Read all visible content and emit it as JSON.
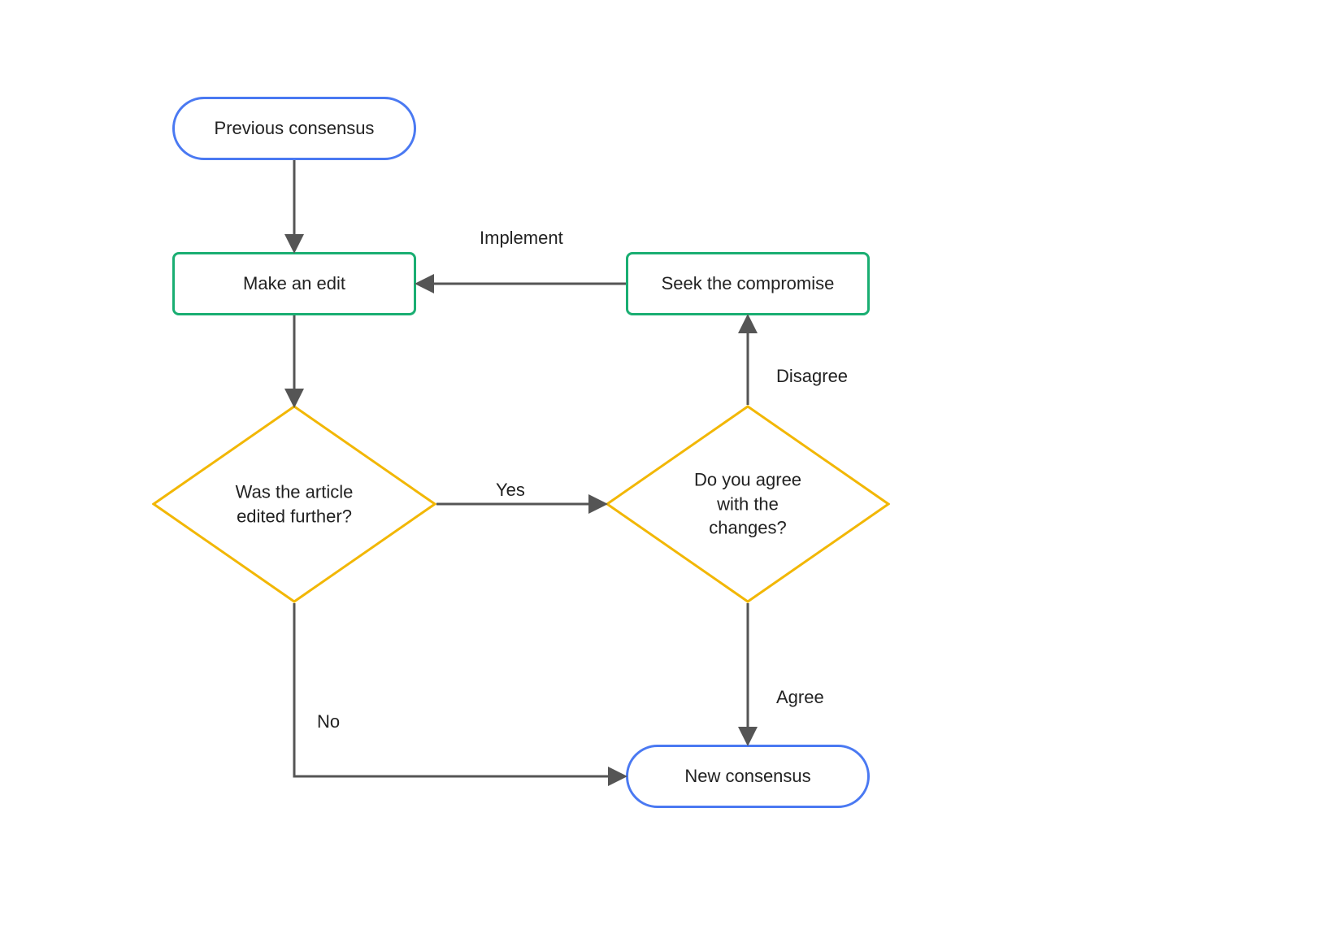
{
  "diagram": {
    "type": "flowchart",
    "nodes": {
      "previous_consensus": {
        "label": "Previous consensus",
        "shape": "terminator",
        "borderColor": "#4A79F2"
      },
      "make_edit": {
        "label": "Make an edit",
        "shape": "process",
        "borderColor": "#1AAE72"
      },
      "seek_compromise": {
        "label": "Seek the compromise",
        "shape": "process",
        "borderColor": "#1AAE72"
      },
      "edited_further": {
        "label": "Was the article\nedited further?",
        "shape": "decision",
        "borderColor": "#F2B705"
      },
      "agree_changes": {
        "label": "Do you agree\nwith the\nchanges?",
        "shape": "decision",
        "borderColor": "#F2B705"
      },
      "new_consensus": {
        "label": "New consensus",
        "shape": "terminator",
        "borderColor": "#4A79F2"
      }
    },
    "edges": [
      {
        "from": "previous_consensus",
        "to": "make_edit",
        "label": ""
      },
      {
        "from": "make_edit",
        "to": "edited_further",
        "label": ""
      },
      {
        "from": "edited_further",
        "to": "agree_changes",
        "label": "Yes"
      },
      {
        "from": "edited_further",
        "to": "new_consensus",
        "label": "No"
      },
      {
        "from": "agree_changes",
        "to": "seek_compromise",
        "label": "Disagree"
      },
      {
        "from": "agree_changes",
        "to": "new_consensus",
        "label": "Agree"
      },
      {
        "from": "seek_compromise",
        "to": "make_edit",
        "label": "Implement"
      }
    ],
    "edge_labels": {
      "yes": "Yes",
      "no": "No",
      "disagree": "Disagree",
      "agree": "Agree",
      "implement": "Implement"
    },
    "colors": {
      "arrow": "#555555",
      "blue": "#4A79F2",
      "green": "#1AAE72",
      "gold": "#F2B705"
    }
  }
}
